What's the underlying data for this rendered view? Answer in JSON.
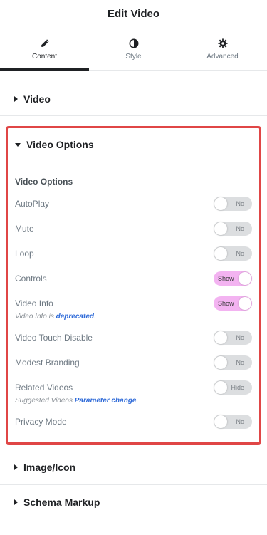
{
  "header": {
    "title": "Edit Video"
  },
  "tabs": [
    {
      "label": "Content",
      "icon": "pencil-icon",
      "active": true
    },
    {
      "label": "Style",
      "icon": "half-circle-icon",
      "active": false
    },
    {
      "label": "Advanced",
      "icon": "gear-icon",
      "active": false
    }
  ],
  "sections": {
    "video": "Video",
    "video_options": "Video Options",
    "image_icon": "Image/Icon",
    "schema_markup": "Schema Markup"
  },
  "options": {
    "subheading": "Video Options",
    "rows": [
      {
        "label": "AutoPlay",
        "toggle": "No"
      },
      {
        "label": "Mute",
        "toggle": "No"
      },
      {
        "label": "Loop",
        "toggle": "No"
      },
      {
        "label": "Controls",
        "toggle": "Show"
      },
      {
        "label": "Video Info",
        "toggle": "Show"
      },
      {
        "label": "Video Touch Disable",
        "toggle": "No"
      },
      {
        "label": "Modest Branding",
        "toggle": "No"
      },
      {
        "label": "Related Videos",
        "toggle": "Hide"
      },
      {
        "label": "Privacy Mode",
        "toggle": "No"
      }
    ],
    "video_info_note": {
      "prefix": "Video Info is ",
      "link": "deprecated",
      "suffix": "."
    },
    "related_note": {
      "prefix": "Suggested Videos ",
      "link": "Parameter change",
      "suffix": "."
    }
  },
  "colors": {
    "highlight_border": "#e04646",
    "toggle_on": "#f3b3f1",
    "toggle_off": "#dcdee0",
    "link": "#2e6ad8"
  }
}
